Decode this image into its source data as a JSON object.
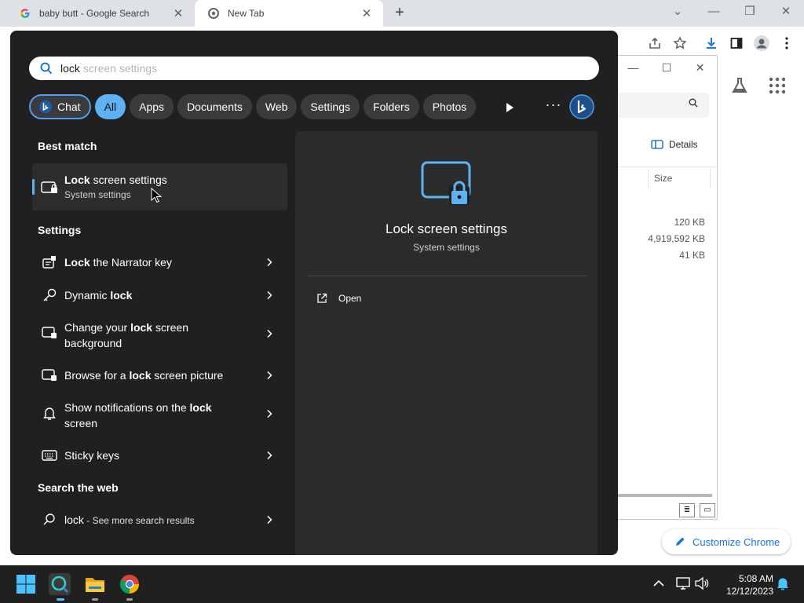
{
  "browser": {
    "tabs": [
      {
        "title": "baby butt - Google Search",
        "favicon": "google-g-icon"
      },
      {
        "title": "New Tab",
        "favicon": "chrome-icon"
      }
    ],
    "customize_label": "Customize Chrome"
  },
  "explorer": {
    "details_label": "Details",
    "size_header": "Size",
    "sizes": [
      "120 KB",
      "4,919,592 KB",
      "41 KB"
    ]
  },
  "search": {
    "query": "lock",
    "autocomplete": "screen settings",
    "filters": [
      "Chat",
      "All",
      "Apps",
      "Documents",
      "Web",
      "Settings",
      "Folders",
      "Photos"
    ],
    "active_filter": "All",
    "best_match_heading": "Best match",
    "best_match": {
      "title_bold": "Lock",
      "title_rest": " screen settings",
      "subtitle": "System settings"
    },
    "settings_heading": "Settings",
    "settings_items": [
      {
        "pre": "",
        "bold": "Lock",
        "post": " the Narrator key",
        "icon": "narrator-icon"
      },
      {
        "pre": "Dynamic ",
        "bold": "lock",
        "post": "",
        "icon": "key-icon"
      },
      {
        "pre": "Change your ",
        "bold": "lock",
        "post": " screen background",
        "icon": "lock-screen-icon"
      },
      {
        "pre": "Browse for a ",
        "bold": "lock",
        "post": " screen picture",
        "icon": "lock-screen-icon"
      },
      {
        "pre": "Show notifications on the ",
        "bold": "lock",
        "post": " screen",
        "icon": "bell-icon"
      },
      {
        "pre": "Sticky keys",
        "bold": "",
        "post": "",
        "icon": "keyboard-icon"
      }
    ],
    "web_heading": "Search the web",
    "web_item": {
      "query": "lock",
      "suffix": " - See more search results"
    },
    "preview": {
      "title": "Lock screen settings",
      "subtitle": "System settings",
      "open_label": "Open"
    }
  },
  "taskbar": {
    "time": "5:08 AM",
    "date": "12/12/2023"
  },
  "colors": {
    "accent": "#5fb2f2",
    "panel_bg": "#202020",
    "tile_bg": "#2b2b2b",
    "chrome_link": "#1a73e8"
  }
}
